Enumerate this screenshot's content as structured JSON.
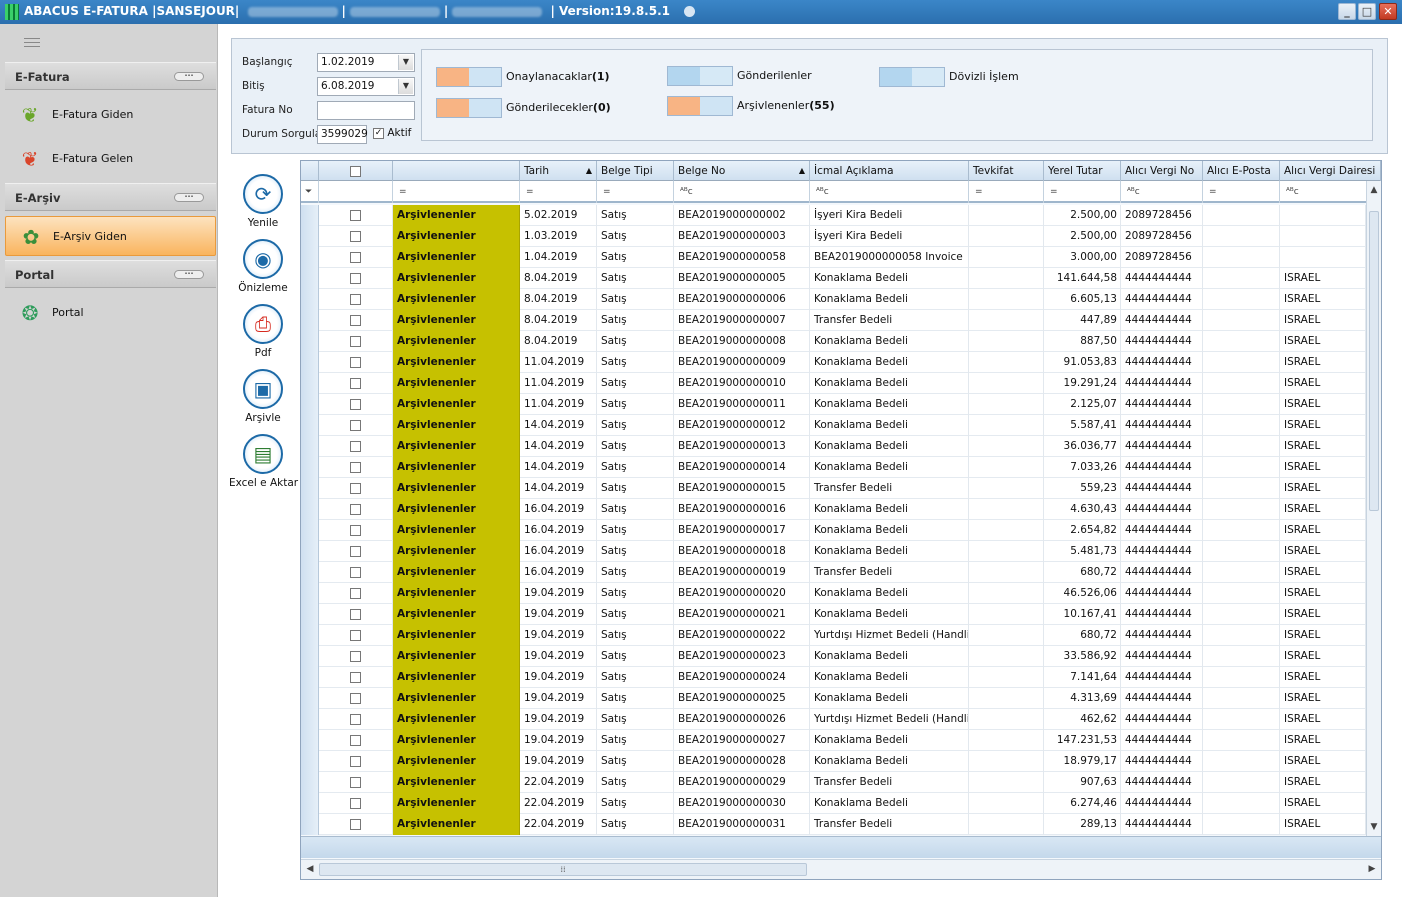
{
  "window": {
    "title": "ABACUS E-FATURA |SANSEJOUR|",
    "sep": "|",
    "version": "| Version:19.8.5.1",
    "controls": {
      "minimize": "_",
      "maximize": "□",
      "close": "✕"
    }
  },
  "sidebar": {
    "groups": [
      {
        "label": "E-Fatura",
        "items": [
          "E-Fatura Giden",
          "E-Fatura Gelen"
        ]
      },
      {
        "label": "E-Arşiv",
        "items": [
          "E-Arşiv Giden"
        ]
      },
      {
        "label": "Portal",
        "items": [
          "Portal"
        ]
      }
    ],
    "active_item": "E-Arşiv Giden"
  },
  "filter": {
    "start_label": "Başlangıç",
    "start_value": "1.02.2019",
    "end_label": "Bitiş",
    "end_value": "6.08.2019",
    "invoice_no_label": "Fatura No",
    "invoice_no_value": "",
    "status_query_label": "Durum Sorgula",
    "status_query_value": "3599029",
    "active_label": "Aktif",
    "active_checked": true
  },
  "legend": [
    {
      "label": "Onaylanacaklar",
      "count": "(1)",
      "color": "#f8b484"
    },
    {
      "label": "Gönderilenler",
      "count": "",
      "color": "#b3d6ef"
    },
    {
      "label": "Dövizli İşlem",
      "count": "",
      "color": "#b3d6ef"
    },
    {
      "label": "Gönderilecekler",
      "count": "(0)",
      "color": "#f8b484"
    },
    {
      "label": "Arşivlenenler",
      "count": "(55)",
      "color": "#f8b484"
    }
  ],
  "toolbar": {
    "refresh": "Yenile",
    "preview": "Önizleme",
    "pdf": "Pdf",
    "archive": "Arşivle",
    "excel": "Excel e Aktar"
  },
  "grid": {
    "columns": [
      "Tarih",
      "Belge Tipi",
      "Belge No",
      "İcmal Açıklama",
      "Tevkifat",
      "Yerel Tutar",
      "Alıcı Vergi No",
      "Alıcı E-Posta",
      "Alıcı Vergi Dairesi"
    ],
    "filter_ops": {
      "eq": "=",
      "abc": "ᴬᴮc"
    },
    "status_color": "#c6c100",
    "rows": [
      {
        "status": "Arşivlenenler",
        "date": "5.02.2019",
        "type": "Satış",
        "no": "BEA2019000000002",
        "desc": "İşyeri Kira Bedeli",
        "amount": "2.500,00",
        "taxno": "2089728456",
        "office": ""
      },
      {
        "status": "Arşivlenenler",
        "date": "1.03.2019",
        "type": "Satış",
        "no": "BEA2019000000003",
        "desc": "İşyeri Kira Bedeli",
        "amount": "2.500,00",
        "taxno": "2089728456",
        "office": ""
      },
      {
        "status": "Arşivlenenler",
        "date": "1.04.2019",
        "type": "Satış",
        "no": "BEA2019000000058",
        "desc": "BEA2019000000058 Invoice",
        "amount": "3.000,00",
        "taxno": "2089728456",
        "office": ""
      },
      {
        "status": "Arşivlenenler",
        "date": "8.04.2019",
        "type": "Satış",
        "no": "BEA2019000000005",
        "desc": "Konaklama Bedeli",
        "amount": "141.644,58",
        "taxno": "4444444444",
        "office": "ISRAEL"
      },
      {
        "status": "Arşivlenenler",
        "date": "8.04.2019",
        "type": "Satış",
        "no": "BEA2019000000006",
        "desc": "Konaklama Bedeli",
        "amount": "6.605,13",
        "taxno": "4444444444",
        "office": "ISRAEL"
      },
      {
        "status": "Arşivlenenler",
        "date": "8.04.2019",
        "type": "Satış",
        "no": "BEA2019000000007",
        "desc": "Transfer Bedeli",
        "amount": "447,89",
        "taxno": "4444444444",
        "office": "ISRAEL"
      },
      {
        "status": "Arşivlenenler",
        "date": "8.04.2019",
        "type": "Satış",
        "no": "BEA2019000000008",
        "desc": "Konaklama Bedeli",
        "amount": "887,50",
        "taxno": "4444444444",
        "office": "ISRAEL"
      },
      {
        "status": "Arşivlenenler",
        "date": "11.04.2019",
        "type": "Satış",
        "no": "BEA2019000000009",
        "desc": "Konaklama Bedeli",
        "amount": "91.053,83",
        "taxno": "4444444444",
        "office": "ISRAEL"
      },
      {
        "status": "Arşivlenenler",
        "date": "11.04.2019",
        "type": "Satış",
        "no": "BEA2019000000010",
        "desc": "Konaklama Bedeli",
        "amount": "19.291,24",
        "taxno": "4444444444",
        "office": "ISRAEL"
      },
      {
        "status": "Arşivlenenler",
        "date": "11.04.2019",
        "type": "Satış",
        "no": "BEA2019000000011",
        "desc": "Konaklama Bedeli",
        "amount": "2.125,07",
        "taxno": "4444444444",
        "office": "ISRAEL"
      },
      {
        "status": "Arşivlenenler",
        "date": "14.04.2019",
        "type": "Satış",
        "no": "BEA2019000000012",
        "desc": "Konaklama Bedeli",
        "amount": "5.587,41",
        "taxno": "4444444444",
        "office": "ISRAEL"
      },
      {
        "status": "Arşivlenenler",
        "date": "14.04.2019",
        "type": "Satış",
        "no": "BEA2019000000013",
        "desc": "Konaklama Bedeli",
        "amount": "36.036,77",
        "taxno": "4444444444",
        "office": "ISRAEL"
      },
      {
        "status": "Arşivlenenler",
        "date": "14.04.2019",
        "type": "Satış",
        "no": "BEA2019000000014",
        "desc": "Konaklama Bedeli",
        "amount": "7.033,26",
        "taxno": "4444444444",
        "office": "ISRAEL"
      },
      {
        "status": "Arşivlenenler",
        "date": "14.04.2019",
        "type": "Satış",
        "no": "BEA2019000000015",
        "desc": "Transfer Bedeli",
        "amount": "559,23",
        "taxno": "4444444444",
        "office": "ISRAEL"
      },
      {
        "status": "Arşivlenenler",
        "date": "16.04.2019",
        "type": "Satış",
        "no": "BEA2019000000016",
        "desc": "Konaklama Bedeli",
        "amount": "4.630,43",
        "taxno": "4444444444",
        "office": "ISRAEL"
      },
      {
        "status": "Arşivlenenler",
        "date": "16.04.2019",
        "type": "Satış",
        "no": "BEA2019000000017",
        "desc": "Konaklama Bedeli",
        "amount": "2.654,82",
        "taxno": "4444444444",
        "office": "ISRAEL"
      },
      {
        "status": "Arşivlenenler",
        "date": "16.04.2019",
        "type": "Satış",
        "no": "BEA2019000000018",
        "desc": "Konaklama Bedeli",
        "amount": "5.481,73",
        "taxno": "4444444444",
        "office": "ISRAEL"
      },
      {
        "status": "Arşivlenenler",
        "date": "16.04.2019",
        "type": "Satış",
        "no": "BEA2019000000019",
        "desc": "Transfer Bedeli",
        "amount": "680,72",
        "taxno": "4444444444",
        "office": "ISRAEL"
      },
      {
        "status": "Arşivlenenler",
        "date": "19.04.2019",
        "type": "Satış",
        "no": "BEA2019000000020",
        "desc": "Konaklama Bedeli",
        "amount": "46.526,06",
        "taxno": "4444444444",
        "office": "ISRAEL"
      },
      {
        "status": "Arşivlenenler",
        "date": "19.04.2019",
        "type": "Satış",
        "no": "BEA2019000000021",
        "desc": "Konaklama Bedeli",
        "amount": "10.167,41",
        "taxno": "4444444444",
        "office": "ISRAEL"
      },
      {
        "status": "Arşivlenenler",
        "date": "19.04.2019",
        "type": "Satış",
        "no": "BEA2019000000022",
        "desc": "Yurtdışı Hizmet Bedeli (Handli...",
        "amount": "680,72",
        "taxno": "4444444444",
        "office": "ISRAEL"
      },
      {
        "status": "Arşivlenenler",
        "date": "19.04.2019",
        "type": "Satış",
        "no": "BEA2019000000023",
        "desc": "Konaklama Bedeli",
        "amount": "33.586,92",
        "taxno": "4444444444",
        "office": "ISRAEL"
      },
      {
        "status": "Arşivlenenler",
        "date": "19.04.2019",
        "type": "Satış",
        "no": "BEA2019000000024",
        "desc": "Konaklama Bedeli",
        "amount": "7.141,64",
        "taxno": "4444444444",
        "office": "ISRAEL"
      },
      {
        "status": "Arşivlenenler",
        "date": "19.04.2019",
        "type": "Satış",
        "no": "BEA2019000000025",
        "desc": "Konaklama Bedeli",
        "amount": "4.313,69",
        "taxno": "4444444444",
        "office": "ISRAEL"
      },
      {
        "status": "Arşivlenenler",
        "date": "19.04.2019",
        "type": "Satış",
        "no": "BEA2019000000026",
        "desc": "Yurtdışı Hizmet Bedeli (Handli...",
        "amount": "462,62",
        "taxno": "4444444444",
        "office": "ISRAEL"
      },
      {
        "status": "Arşivlenenler",
        "date": "19.04.2019",
        "type": "Satış",
        "no": "BEA2019000000027",
        "desc": "Konaklama Bedeli",
        "amount": "147.231,53",
        "taxno": "4444444444",
        "office": "ISRAEL"
      },
      {
        "status": "Arşivlenenler",
        "date": "19.04.2019",
        "type": "Satış",
        "no": "BEA2019000000028",
        "desc": "Konaklama Bedeli",
        "amount": "18.979,17",
        "taxno": "4444444444",
        "office": "ISRAEL"
      },
      {
        "status": "Arşivlenenler",
        "date": "22.04.2019",
        "type": "Satış",
        "no": "BEA2019000000029",
        "desc": "Transfer Bedeli",
        "amount": "907,63",
        "taxno": "4444444444",
        "office": "ISRAEL"
      },
      {
        "status": "Arşivlenenler",
        "date": "22.04.2019",
        "type": "Satış",
        "no": "BEA2019000000030",
        "desc": "Konaklama Bedeli",
        "amount": "6.274,46",
        "taxno": "4444444444",
        "office": "ISRAEL"
      },
      {
        "status": "Arşivlenenler",
        "date": "22.04.2019",
        "type": "Satış",
        "no": "BEA2019000000031",
        "desc": "Transfer Bedeli",
        "amount": "289,13",
        "taxno": "4444444444",
        "office": "ISRAEL"
      }
    ]
  }
}
